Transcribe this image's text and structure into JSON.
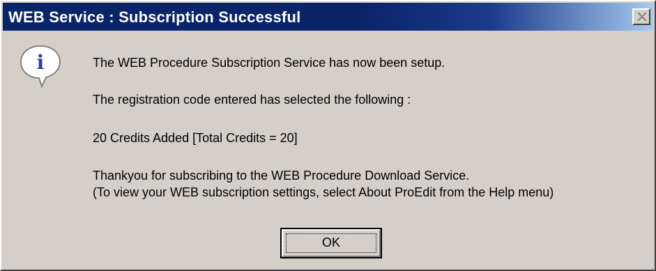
{
  "window": {
    "title": "WEB Service : Subscription Successful",
    "close_icon": "close-icon"
  },
  "icon": {
    "name": "info-icon",
    "glyph": "i"
  },
  "message": {
    "line1": "The WEB Procedure Subscription Service has now been setup.",
    "line2": "The registration code entered has selected the following :",
    "line3": "20 Credits Added [Total Credits = 20]",
    "line4": "Thankyou for subscribing to the WEB Procedure Download Service.",
    "line5": "(To view your WEB subscription settings, select About ProEdit from the Help menu)"
  },
  "buttons": {
    "ok_label": "OK"
  },
  "colors": {
    "titlebar": "#0a246a",
    "face": "#d4d0c8",
    "icon_blue": "#1f3fb4"
  }
}
